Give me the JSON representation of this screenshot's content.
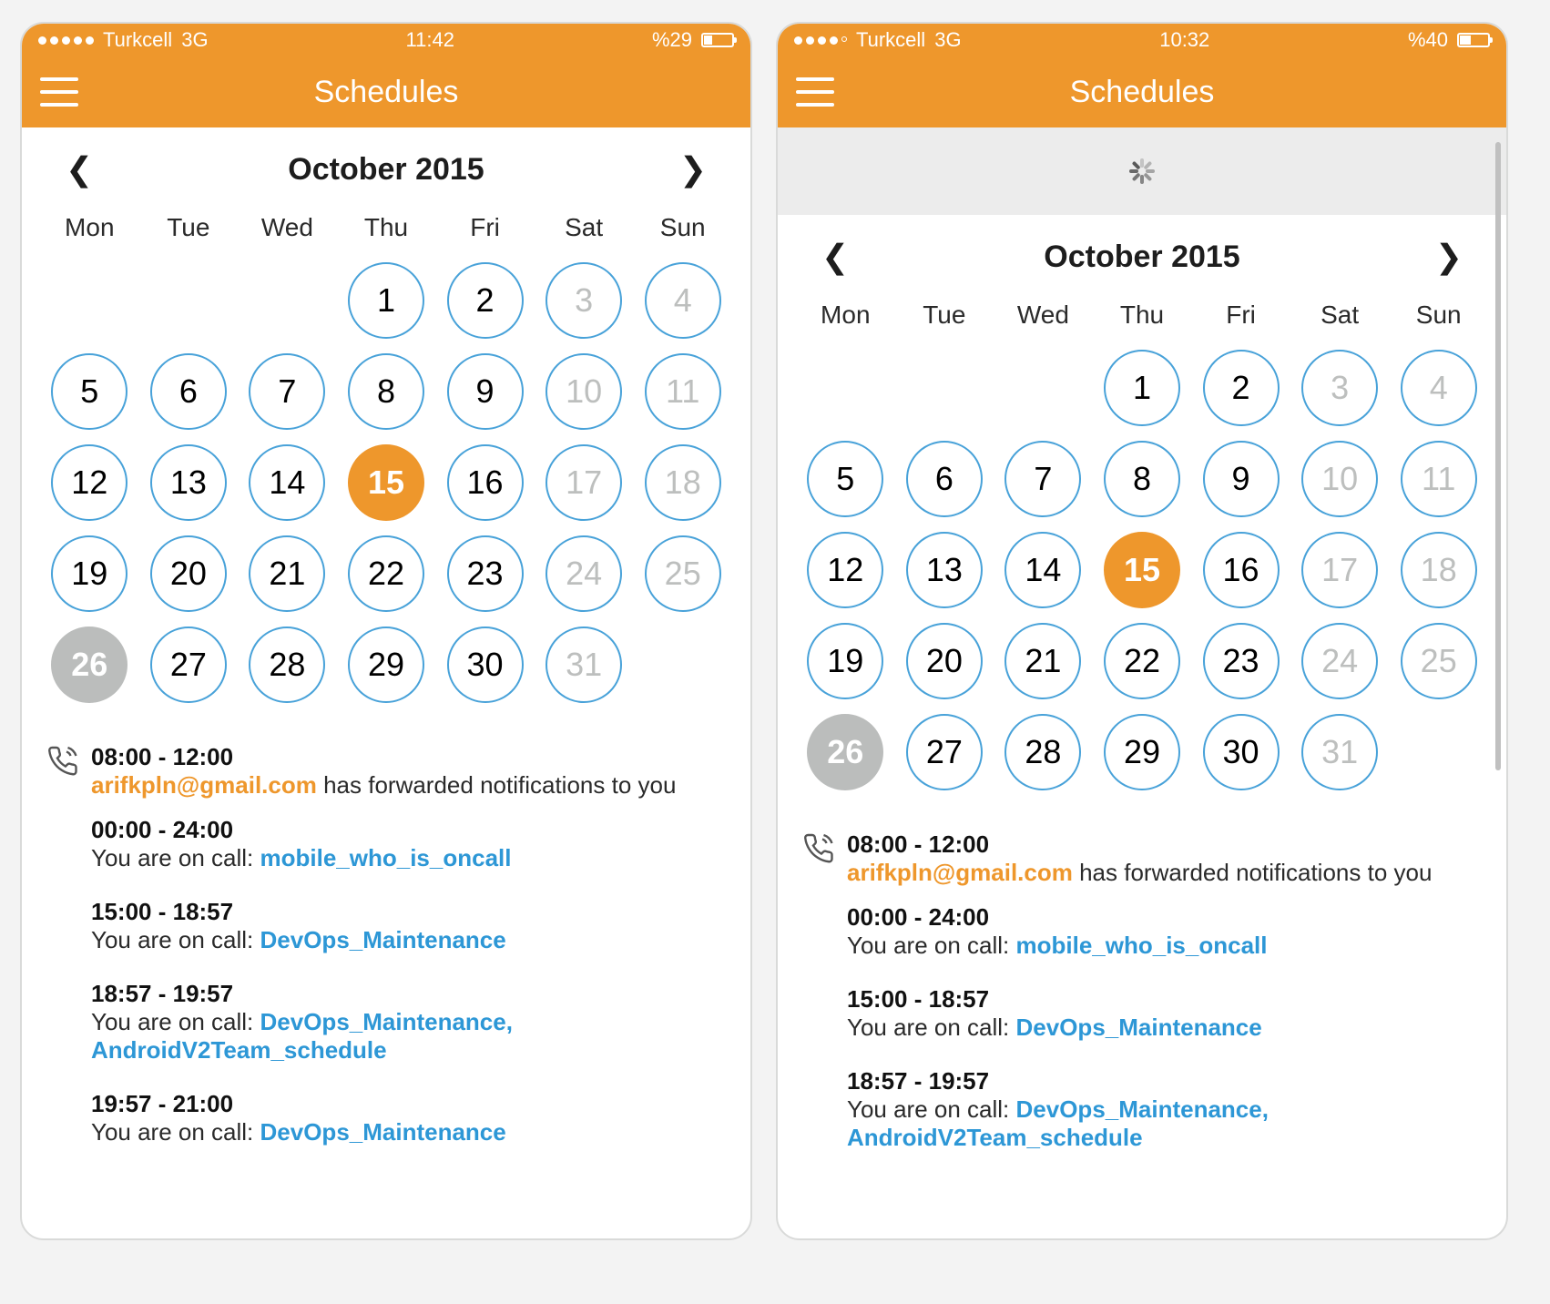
{
  "colors": {
    "accent": "#ee972c",
    "link": "#2d97d6",
    "circle": "#48a2d9"
  },
  "weekdays": [
    "Mon",
    "Tue",
    "Wed",
    "Thu",
    "Fri",
    "Sat",
    "Sun"
  ],
  "screens": [
    {
      "status": {
        "carrier": "Turkcell",
        "network": "3G",
        "time": "11:42",
        "battery_text": "%29",
        "battery_pct": 29,
        "signal_filled": 5
      },
      "title": "Schedules",
      "loading": false,
      "month_label": "October 2015",
      "calendar": {
        "leading_blanks": 3,
        "days": [
          {
            "n": 1
          },
          {
            "n": 2
          },
          {
            "n": 3,
            "w": true
          },
          {
            "n": 4,
            "w": true
          },
          {
            "n": 5
          },
          {
            "n": 6
          },
          {
            "n": 7
          },
          {
            "n": 8
          },
          {
            "n": 9
          },
          {
            "n": 10,
            "w": true
          },
          {
            "n": 11,
            "w": true
          },
          {
            "n": 12
          },
          {
            "n": 13
          },
          {
            "n": 14
          },
          {
            "n": 15,
            "sel": true
          },
          {
            "n": 16
          },
          {
            "n": 17,
            "w": true
          },
          {
            "n": 18,
            "w": true
          },
          {
            "n": 19
          },
          {
            "n": 20
          },
          {
            "n": 21
          },
          {
            "n": 22
          },
          {
            "n": 23
          },
          {
            "n": 24,
            "w": true
          },
          {
            "n": 25,
            "w": true
          },
          {
            "n": 26,
            "today": true
          },
          {
            "n": 27
          },
          {
            "n": 28
          },
          {
            "n": 29
          },
          {
            "n": 30
          },
          {
            "n": 31,
            "w": true
          }
        ]
      },
      "events": [
        {
          "icon": true,
          "time": "08:00 - 12:00",
          "parts": [
            {
              "t": "arifkpln@gmail.com",
              "c": "orange"
            },
            {
              "t": " has forwarded notifications to you"
            }
          ]
        },
        {
          "time": "00:00 - 24:00",
          "parts": [
            {
              "t": "You are on call: "
            },
            {
              "t": "mobile_who_is_oncall",
              "c": "blue"
            }
          ]
        },
        {
          "gap": true,
          "time": "15:00 - 18:57",
          "parts": [
            {
              "t": "You are on call: "
            },
            {
              "t": "DevOps_Maintenance",
              "c": "blue"
            }
          ]
        },
        {
          "gap": true,
          "time": "18:57 - 19:57",
          "parts": [
            {
              "t": "You are on call: "
            },
            {
              "t": "DevOps_Maintenance, AndroidV2Team_schedule",
              "c": "blue"
            }
          ]
        },
        {
          "gap": true,
          "time": "19:57 - 21:00",
          "parts": [
            {
              "t": "You are on call: "
            },
            {
              "t": "DevOps_Maintenance",
              "c": "blue"
            }
          ]
        }
      ]
    },
    {
      "status": {
        "carrier": "Turkcell",
        "network": "3G",
        "time": "10:32",
        "battery_text": "%40",
        "battery_pct": 40,
        "signal_filled": 4
      },
      "title": "Schedules",
      "loading": true,
      "month_label": "October 2015",
      "calendar": {
        "leading_blanks": 3,
        "days": [
          {
            "n": 1
          },
          {
            "n": 2
          },
          {
            "n": 3,
            "w": true
          },
          {
            "n": 4,
            "w": true
          },
          {
            "n": 5
          },
          {
            "n": 6
          },
          {
            "n": 7
          },
          {
            "n": 8
          },
          {
            "n": 9
          },
          {
            "n": 10,
            "w": true
          },
          {
            "n": 11,
            "w": true
          },
          {
            "n": 12
          },
          {
            "n": 13
          },
          {
            "n": 14
          },
          {
            "n": 15,
            "sel": true
          },
          {
            "n": 16
          },
          {
            "n": 17,
            "w": true
          },
          {
            "n": 18,
            "w": true
          },
          {
            "n": 19
          },
          {
            "n": 20
          },
          {
            "n": 21
          },
          {
            "n": 22
          },
          {
            "n": 23
          },
          {
            "n": 24,
            "w": true
          },
          {
            "n": 25,
            "w": true
          },
          {
            "n": 26,
            "today": true
          },
          {
            "n": 27
          },
          {
            "n": 28
          },
          {
            "n": 29
          },
          {
            "n": 30
          },
          {
            "n": 31,
            "w": true
          }
        ]
      },
      "events": [
        {
          "icon": true,
          "time": "08:00 - 12:00",
          "parts": [
            {
              "t": "arifkpln@gmail.com",
              "c": "orange"
            },
            {
              "t": " has forwarded notifications to you"
            }
          ]
        },
        {
          "time": "00:00 - 24:00",
          "parts": [
            {
              "t": "You are on call: "
            },
            {
              "t": "mobile_who_is_oncall",
              "c": "blue"
            }
          ]
        },
        {
          "gap": true,
          "time": "15:00 - 18:57",
          "parts": [
            {
              "t": "You are on call: "
            },
            {
              "t": "DevOps_Maintenance",
              "c": "blue"
            }
          ]
        },
        {
          "gap": true,
          "time": "18:57 - 19:57",
          "parts": [
            {
              "t": "You are on call: "
            },
            {
              "t": "DevOps_Maintenance, AndroidV2Team_schedule",
              "c": "blue"
            }
          ]
        }
      ]
    }
  ]
}
